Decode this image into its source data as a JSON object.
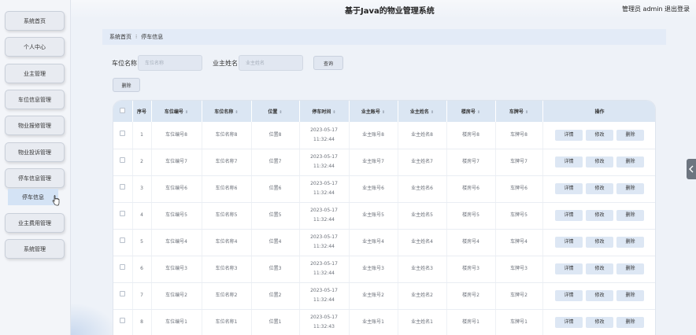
{
  "header": {
    "title": "基于Java的物业管理系统",
    "admin_label": "管理员 admin",
    "logout_label": "退出登录"
  },
  "sidebar": {
    "items": [
      {
        "label": "系统首页"
      },
      {
        "label": "个人中心"
      },
      {
        "label": "业主管理"
      },
      {
        "label": "车位信息管理"
      },
      {
        "label": "物业报修管理"
      },
      {
        "label": "物业投诉管理"
      },
      {
        "label": "停车信息管理"
      },
      {
        "label": "业主费用管理"
      },
      {
        "label": "系统管理"
      }
    ],
    "sub_item": {
      "label": "停车信息"
    }
  },
  "breadcrumb": {
    "home": "系统首页",
    "current": "停车信息"
  },
  "search": {
    "field1_label": "车位名称",
    "field1_placeholder": "车位名称",
    "field2_label": "业主姓名",
    "field2_placeholder": "业主姓名",
    "query_label": "查询",
    "delete_label": "删除"
  },
  "table": {
    "columns": [
      "序号",
      "车位编号",
      "车位名称",
      "位置",
      "停车时间",
      "业主账号",
      "业主姓名",
      "楼房号",
      "车牌号",
      "操作"
    ],
    "rows": [
      {
        "no": "1",
        "code": "车位编号8",
        "name": "车位名称8",
        "loc": "位置8",
        "time": "2023-05-17 11:32:44",
        "acct": "业主账号8",
        "owner": "业主姓名8",
        "bld": "楼房号8",
        "plate": "车牌号8"
      },
      {
        "no": "2",
        "code": "车位编号7",
        "name": "车位名称7",
        "loc": "位置7",
        "time": "2023-05-17 11:32:44",
        "acct": "业主账号7",
        "owner": "业主姓名7",
        "bld": "楼房号7",
        "plate": "车牌号7"
      },
      {
        "no": "3",
        "code": "车位编号6",
        "name": "车位名称6",
        "loc": "位置6",
        "time": "2023-05-17 11:32:44",
        "acct": "业主账号6",
        "owner": "业主姓名6",
        "bld": "楼房号6",
        "plate": "车牌号6"
      },
      {
        "no": "4",
        "code": "车位编号5",
        "name": "车位名称5",
        "loc": "位置5",
        "time": "2023-05-17 11:32:44",
        "acct": "业主账号5",
        "owner": "业主姓名5",
        "bld": "楼房号5",
        "plate": "车牌号5"
      },
      {
        "no": "5",
        "code": "车位编号4",
        "name": "车位名称4",
        "loc": "位置4",
        "time": "2023-05-17 11:32:44",
        "acct": "业主账号4",
        "owner": "业主姓名4",
        "bld": "楼房号4",
        "plate": "车牌号4"
      },
      {
        "no": "6",
        "code": "车位编号3",
        "name": "车位名称3",
        "loc": "位置3",
        "time": "2023-05-17 11:32:44",
        "acct": "业主账号3",
        "owner": "业主姓名3",
        "bld": "楼房号3",
        "plate": "车牌号3"
      },
      {
        "no": "7",
        "code": "车位编号2",
        "name": "车位名称2",
        "loc": "位置2",
        "time": "2023-05-17 11:32:44",
        "acct": "业主账号2",
        "owner": "业主姓名2",
        "bld": "楼房号2",
        "plate": "车牌号2"
      },
      {
        "no": "8",
        "code": "车位编号1",
        "name": "车位名称1",
        "loc": "位置1",
        "time": "2023-05-17 11:32:43",
        "acct": "业主账号1",
        "owner": "业主姓名1",
        "bld": "楼房号1",
        "plate": "车牌号1"
      }
    ],
    "action_labels": {
      "detail": "详情",
      "edit": "修改",
      "delete": "删除"
    }
  },
  "icons": {
    "sort": "sort-icon",
    "breadcrumb_separator": "breadcrumb-separator-icon",
    "collapse": "chevron-left-icon",
    "cursor": "hand-cursor-icon"
  },
  "colors": {
    "header_row": "#dbe6f3",
    "button": "#dde7f4",
    "breadcrumb": "#e3ebf7"
  }
}
